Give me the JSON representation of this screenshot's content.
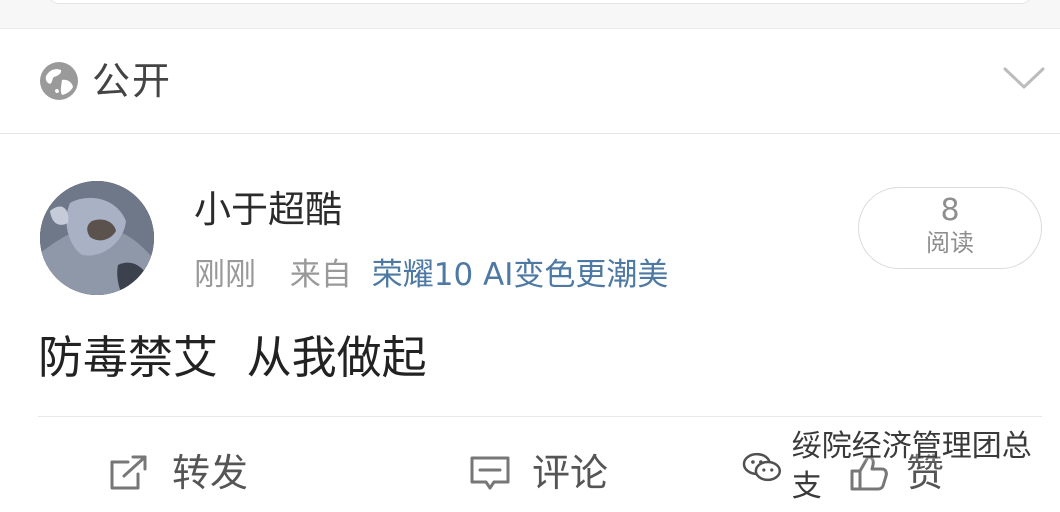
{
  "visibility": {
    "icon": "globe-icon",
    "label": "公开",
    "dropdown_icon": "chevron-down-icon"
  },
  "post": {
    "author": "小于超酷",
    "time": "刚刚",
    "source_prefix": "来自",
    "source_device": "荣耀10 AI变色更潮美",
    "read_count": "8",
    "read_label": "阅读",
    "content": "防毒禁艾  从我做起"
  },
  "actions": [
    {
      "label": "转发",
      "icon": "repost-icon"
    },
    {
      "label": "评论",
      "icon": "comment-icon"
    },
    {
      "label": "赞",
      "icon": "like-icon"
    }
  ],
  "watermark": {
    "text": "绥院经济管理团总支",
    "icon": "wechat-icon"
  },
  "colors": {
    "text_primary": "#222222",
    "text_secondary": "#999999",
    "source_link": "#4d79a3",
    "divider": "#e8e8e8"
  }
}
